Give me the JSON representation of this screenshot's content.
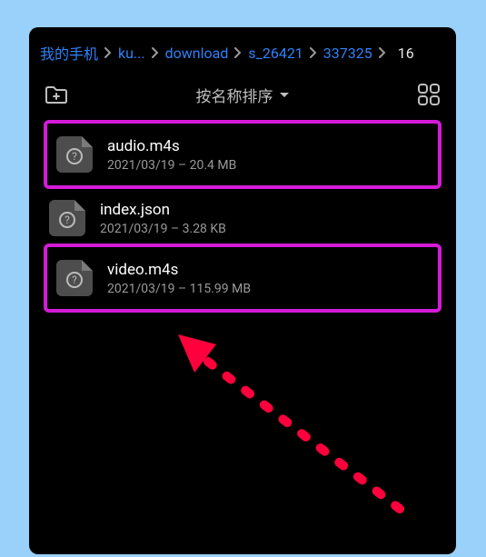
{
  "breadcrumb": {
    "items": [
      {
        "label": "我的手机"
      },
      {
        "label": "ku..."
      },
      {
        "label": "download"
      },
      {
        "label": "s_26421"
      },
      {
        "label": "337325"
      }
    ],
    "current": "16"
  },
  "toolbar": {
    "sort_label": "按名称排序"
  },
  "files": [
    {
      "name": "audio.m4s",
      "date": "2021/03/19",
      "size": "20.4 MB",
      "highlighted": true
    },
    {
      "name": "index.json",
      "date": "2021/03/19",
      "size": "3.28 KB",
      "highlighted": false
    },
    {
      "name": "video.m4s",
      "date": "2021/03/19",
      "size": "115.99 MB",
      "highlighted": true
    }
  ],
  "annotation": {
    "color": "#ff003c"
  }
}
